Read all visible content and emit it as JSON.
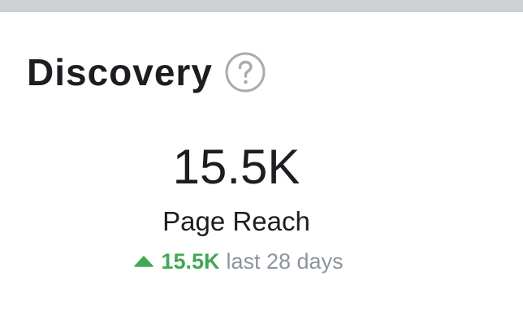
{
  "header": {
    "title": "Discovery"
  },
  "metric": {
    "value": "15.5K",
    "label": "Page Reach"
  },
  "trend": {
    "direction": "up",
    "value": "15.5K",
    "period": "last 28 days"
  },
  "colors": {
    "top_bar": "#cdd0d4",
    "text_primary": "#1c1e21",
    "trend_up": "#42a756",
    "text_secondary": "#8d949e",
    "help_icon": "#a8abaf"
  },
  "icons": {
    "help": "question-circle-icon",
    "trend": "triangle-up-icon"
  }
}
